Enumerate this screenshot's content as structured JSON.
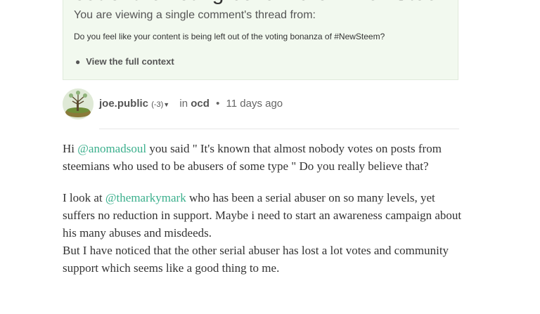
{
  "context": {
    "heading": "out of the voting bonanza of #NewSteem?",
    "viewing_note": "You are viewing a single comment's thread from:",
    "post_title": "Do you feel like your content is being left out of the voting bonanza of #NewSteem?",
    "full_context_link": "View the full context"
  },
  "comment": {
    "author": "joe.public",
    "reputation": "(-3)",
    "in_label": "in",
    "category": "ocd",
    "separator": "•",
    "timestamp": "11 days ago",
    "paragraph1": {
      "prefix": "Hi ",
      "mention": "@anomadsoul",
      "suffix": " you said \" It's known that almost nobody votes on posts from steemians who used to be abusers of some type \" Do you really believe that?"
    },
    "paragraph2": {
      "prefix": "I look at ",
      "mention": "@themarkymark",
      "suffix": " who has been a serial abuser on so many levels, yet suffers no reduction in support. Maybe i need to start an awareness campaign about his many abuses and misdeeds.",
      "line2": "But I have noticed that the other serial abuser has lost a lot votes and community support which seems like a good thing to me."
    }
  },
  "colors": {
    "context_bg": "#f2f9ef",
    "mention": "#3aaf8c",
    "text": "#333333"
  }
}
